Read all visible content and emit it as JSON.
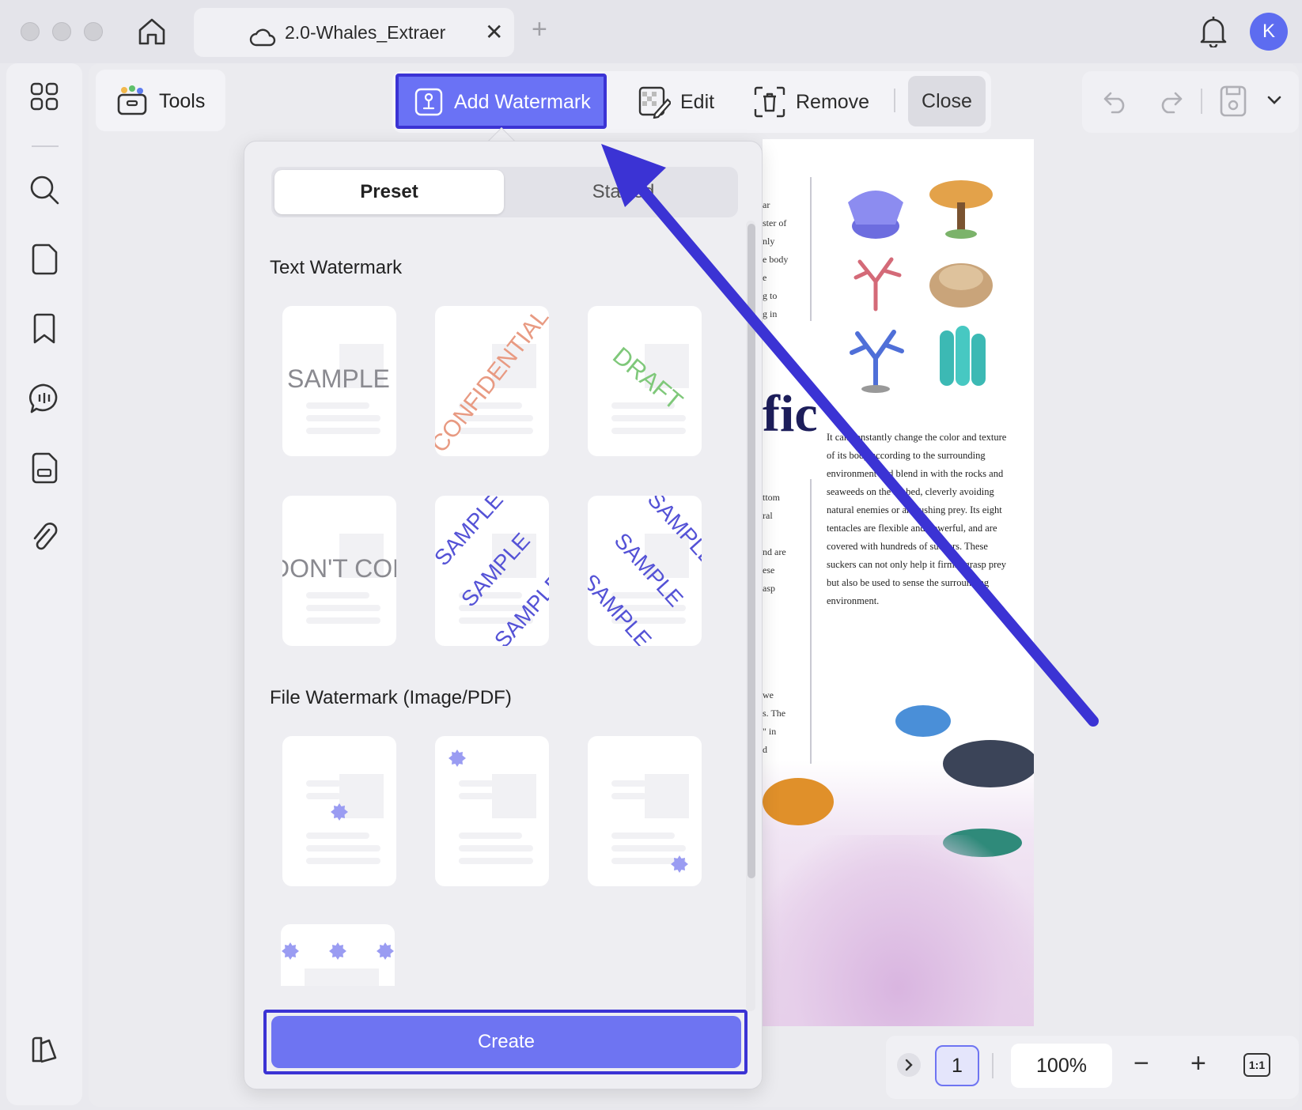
{
  "titlebar": {
    "tab_title": "2.0-Whales_Extraer",
    "tab_close": "✕",
    "new_tab": "+",
    "avatar_letter": "K"
  },
  "toolbar": {
    "tools_label": "Tools",
    "add_watermark_label": "Add Watermark",
    "edit_label": "Edit",
    "remove_label": "Remove",
    "close_label": "Close"
  },
  "panel": {
    "tabs": {
      "preset": "Preset",
      "starred": "Starred"
    },
    "text_section_title": "Text Watermark",
    "file_section_title": "File Watermark (Image/PDF)",
    "text_cards": [
      "SAMPLE",
      "CONFIDENTIAL",
      "DRAFT",
      "DON'T COPY",
      "SAMPLE",
      "SAMPLE"
    ],
    "create_label": "Create"
  },
  "document": {
    "heading_fragment": "fic",
    "body_paragraph": "It can constantly change the color and texture of its body according to the surrounding environment and blend in with the rocks and seaweeds on the seabed, cleverly avoiding natural enemies or ambushing prey. Its eight tentacles are flexible and powerful, and are covered with hundreds of suckers. These suckers can not only help it firmly grasp prey but also be used to sense the surrounding environment.",
    "fragments_top": [
      "ar",
      "ster of",
      "nly",
      "e body",
      "e",
      "g to",
      "g in"
    ],
    "fragments_mid": [
      "ttom",
      "ral",
      "",
      "nd are",
      "ese",
      "asp"
    ],
    "fragments_low": [
      "we",
      "s. The",
      "\" in",
      "d"
    ]
  },
  "statusbar": {
    "page_number": "1",
    "zoom": "100%",
    "zoom_minus": "−",
    "zoom_plus": "+",
    "fit_label": "1:1"
  },
  "colors": {
    "accent": "#6e74f2",
    "highlight_border": "#3b33d4",
    "watermark_blue": "#5452d6",
    "watermark_red": "#e89a82",
    "watermark_green": "#7fc87a"
  }
}
